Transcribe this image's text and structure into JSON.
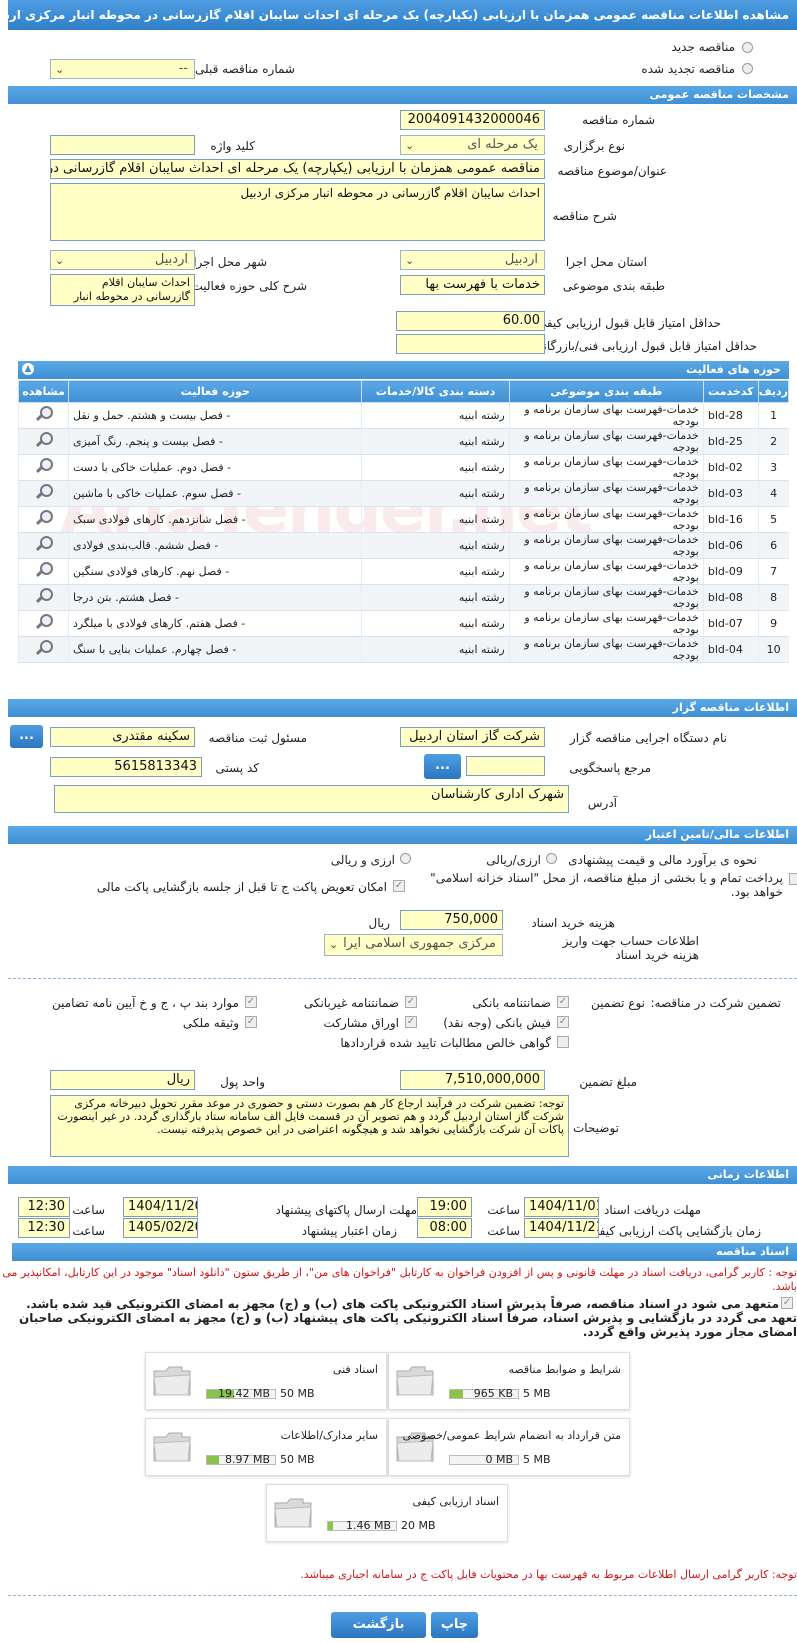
{
  "header": {
    "title": "مشاهده اطلاعات مناقصه عمومی همزمان با ارزیابی (یکپارچه) یک مرحله ای احداث سایبان اقلام گازرسانی در محوطه انبار مرکزی اردبیل"
  },
  "tender_type": {
    "new_label": "مناقصه جدید",
    "renewed_label": "مناقصه تجدید شده",
    "prev_label": "شماره مناقصه قبلی",
    "prev_value": "--"
  },
  "general": {
    "section_title": "مشخصات مناقصه عمومی",
    "number_label": "شماره مناقصه",
    "number": "2004091432000046",
    "type_label": "نوع برگزاری",
    "type": "یک مرحله ای",
    "keyword_label": "کلید واژه",
    "keyword": "",
    "subject_label": "عنوان/موضوع مناقصه",
    "subject": "مناقصه عمومی همزمان با ارزیابی (یکپارچه) یک مرحله ای احداث سایبان اقلام گازرسانی در محوطه انبار مرکزی اردبیل",
    "desc_label": "شرح مناقصه",
    "desc": "احداث سایبان اقلام گازرسانی در محوطه انبار مرکزی اردبیل",
    "province_label": "استان محل اجرا",
    "province": "اردبیل",
    "city_label": "شهر محل اجرا",
    "city": "اردبیل",
    "category_label": "طبقه بندی موضوعی",
    "category": "خدمات با فهرست بها",
    "activity_desc_label": "شرح کلی حوزه فعالیت",
    "activity_desc": "احداث سایبان اقلام گازرسانی در محوطه انبار مرکزی اردبیل",
    "min_quality_label": "حداقل امتیاز قابل قبول ارزیابی کیفی",
    "min_quality": "60.00",
    "min_tech_label": "حداقل امتیاز قابل قبول ارزیابی فنی/بازرگانی",
    "min_tech": ""
  },
  "activities": {
    "section_title": "حوزه های فعالیت",
    "columns": [
      "ردیف",
      "کدخدمت",
      "طبقه بندی موضوعی",
      "دسته بندی کالا/خدمات",
      "حوزه فعالیت",
      "مشاهده"
    ],
    "rows": [
      {
        "n": "1",
        "code": "bld-28",
        "cat": "خدمات-فهرست بهای سازمان برنامه و بودجه",
        "group": "رشته ابنیه",
        "field": "- فصل بیست و هشتم. حمل و نقل"
      },
      {
        "n": "2",
        "code": "bld-25",
        "cat": "خدمات-فهرست بهای سازمان برنامه و بودجه",
        "group": "رشته ابنیه",
        "field": "- فصل بیست و پنجم. رنگ آمیزی"
      },
      {
        "n": "3",
        "code": "bld-02",
        "cat": "خدمات-فهرست بهای سازمان برنامه و بودجه",
        "group": "رشته ابنیه",
        "field": "- فصل دوم. عملیات خاکی با دست"
      },
      {
        "n": "4",
        "code": "bld-03",
        "cat": "خدمات-فهرست بهای سازمان برنامه و بودجه",
        "group": "رشته ابنیه",
        "field": "- فصل سوم. عملیات خاکی با ماشین"
      },
      {
        "n": "5",
        "code": "bld-16",
        "cat": "خدمات-فهرست بهای سازمان برنامه و بودجه",
        "group": "رشته ابنیه",
        "field": "- فصل شانزدهم. کارهای فولادی سبک"
      },
      {
        "n": "6",
        "code": "bld-06",
        "cat": "خدمات-فهرست بهای سازمان برنامه و بودجه",
        "group": "رشته ابنیه",
        "field": "- فصل ششم. قالب‌بندی فولادی"
      },
      {
        "n": "7",
        "code": "bld-09",
        "cat": "خدمات-فهرست بهای سازمان برنامه و بودجه",
        "group": "رشته ابنیه",
        "field": "- فصل نهم. کارهای فولادی سنگین"
      },
      {
        "n": "8",
        "code": "bld-08",
        "cat": "خدمات-فهرست بهای سازمان برنامه و بودجه",
        "group": "رشته ابنیه",
        "field": "- فصل هشتم. بتن درجا"
      },
      {
        "n": "9",
        "code": "bld-07",
        "cat": "خدمات-فهرست بهای سازمان برنامه و بودجه",
        "group": "رشته ابنیه",
        "field": "- فصل هفتم. کارهای فولادی با میلگرد"
      },
      {
        "n": "10",
        "code": "bld-04",
        "cat": "خدمات-فهرست بهای سازمان برنامه و بودجه",
        "group": "رشته ابنیه",
        "field": "- فصل چهارم. عملیات بنایی با سنگ"
      }
    ]
  },
  "organizer": {
    "section_title": "اطلاعات مناقصه گزار",
    "org_label": "نام دستگاه اجرایی مناقصه گزار",
    "org": "شرکت گاز استان اردبیل",
    "resp_label": "مسئول ثبت مناقصه",
    "resp": "سکینه  مقتدری",
    "ref_label": "مرجع پاسخگویی",
    "ref": "",
    "postal_label": "کد پستی",
    "postal": "5615813343",
    "addr_label": "آدرس",
    "addr": "شهرک اداری کارشناسان",
    "dots": "..."
  },
  "finance": {
    "section_title": "اطلاعات مالی/تامین اعتبار",
    "estimate_label": "نحوه ی برآورد مالی و قیمت پیشنهادی",
    "opt_rial": "ارزی/ریالی",
    "opt_both": "ارزی و ریالی",
    "islamic_text": "پرداخت تمام و یا بخشی از مبلغ مناقصه، از محل \"اسناد خزانه اسلامی\" خواهد بود.",
    "swap_text": "امکان تعویض پاکت ج تا قبل از جلسه بازگشایی پاکت مالی",
    "doc_cost_label": "هزینه خرید اسناد",
    "doc_cost": "750,000",
    "rial": "ریال",
    "account_label": "اطلاعات حساب جهت واریز هزینه خرید اسناد",
    "account": "مرکزی جمهوری اسلامی ایرا",
    "guarantee_label": "تضمین شرکت در مناقصه:",
    "guarantee_type_label": "نوع تضمین",
    "g1": "ضمانتنامه بانکی",
    "g2": "ضمانتنامه غیربانکی",
    "g3": "موارد بند پ ، ج و خ آیین نامه تضامین",
    "g4": "فیش بانکی (وجه نقد)",
    "g5": "اوراق مشارکت",
    "g6": "وثیقه ملکی",
    "g7": "گواهی خالص مطالبات تایید شده قراردادها",
    "amount_label": "مبلغ تضمین",
    "amount": "7,510,000,000",
    "currency_label": "واحد پول",
    "currency": "ریال",
    "notes_label": "توضیحات",
    "notes": "توجه: تضمین شرکت در فرآیند ارجاع کار هم بصورت دستی و حضوری در موعد مقرر تحویل دبیرخانه مرکزی شرکت گاز استان اردبیل گردد و هم تصویر آن در قسمت فایل الف سامانه ستاد بارگذاری گردد. در غیر اینصورت پاکات آن شرکت بازگشایی نخواهد شد و هیچگونه اعتراضی در این خصوص پذیرفته نیست."
  },
  "timing": {
    "section_title": "اطلاعات زمانی",
    "recv_label": "مهلت دریافت اسناد",
    "recv_date": "1404/11/01",
    "recv_time": "19:00",
    "send_label": "مهلت ارسال پاکتهای پیشنهاد",
    "send_date": "1404/11/20",
    "send_time": "12:30",
    "open_label": "زمان بازگشایی پاکت ارزیابی کیفی",
    "open_date": "1404/11/21",
    "open_time": "08:00",
    "valid_label": "زمان اعتبار پیشنهاد",
    "valid_date": "1405/02/20",
    "valid_time": "12:30",
    "time_label": "ساعت"
  },
  "documents": {
    "section_title": "اسناد مناقصه",
    "notice": "توجه : کاربر گرامی، دریافت اسناد در مهلت قانونی و پس از افزودن فراخوان به کارتابل \"فراخوان های من\"، از طریق ستون \"دانلود اسناد\" موجود در این کارتابل، امکانپذیر می باشد.",
    "commit": "متعهد می شود در اسناد مناقصه، صرفاً پذیرش اسناد الکترونیکی پاکت های (ب) و (ج) مجهز به امضای الکترونیکی قید شده باشد. تعهد می گردد در بازگشایی و پذیرش اسناد، صرفاً اسناد الکترونیکی پاکت های پیشنهاد (ب) و (ج) مجهز به امضای الکترونیکی صاحبان امضای مجاز مورد پذیرش واقع گردد.",
    "items": [
      {
        "name": "شرایط و ضوابط مناقصه",
        "max": "5 MB",
        "size": "965 KB",
        "fill": 0.19
      },
      {
        "name": "اسناد فنی",
        "max": "50 MB",
        "size": "19.42 MB",
        "fill": 0.39
      },
      {
        "name": "متن قرارداد به انضمام شرایط عمومی/خصوصی",
        "max": "5 MB",
        "size": "0 MB",
        "fill": 0.0
      },
      {
        "name": "سایر مدارک/اطلاعات",
        "max": "50 MB",
        "size": "8.97 MB",
        "fill": 0.18
      },
      {
        "name": "اسناد ارزیابی کیفی",
        "max": "20 MB",
        "size": "1.46 MB",
        "fill": 0.07
      }
    ],
    "footer_note": "توجه: کاربر گرامی ارسال اطلاعات مربوط به فهرست بها در محتویات فایل پاکت ج در سامانه اجباری میباشد."
  },
  "buttons": {
    "print": "چاپ",
    "back": "بازگشت"
  },
  "watermark": "AriaTender.net"
}
